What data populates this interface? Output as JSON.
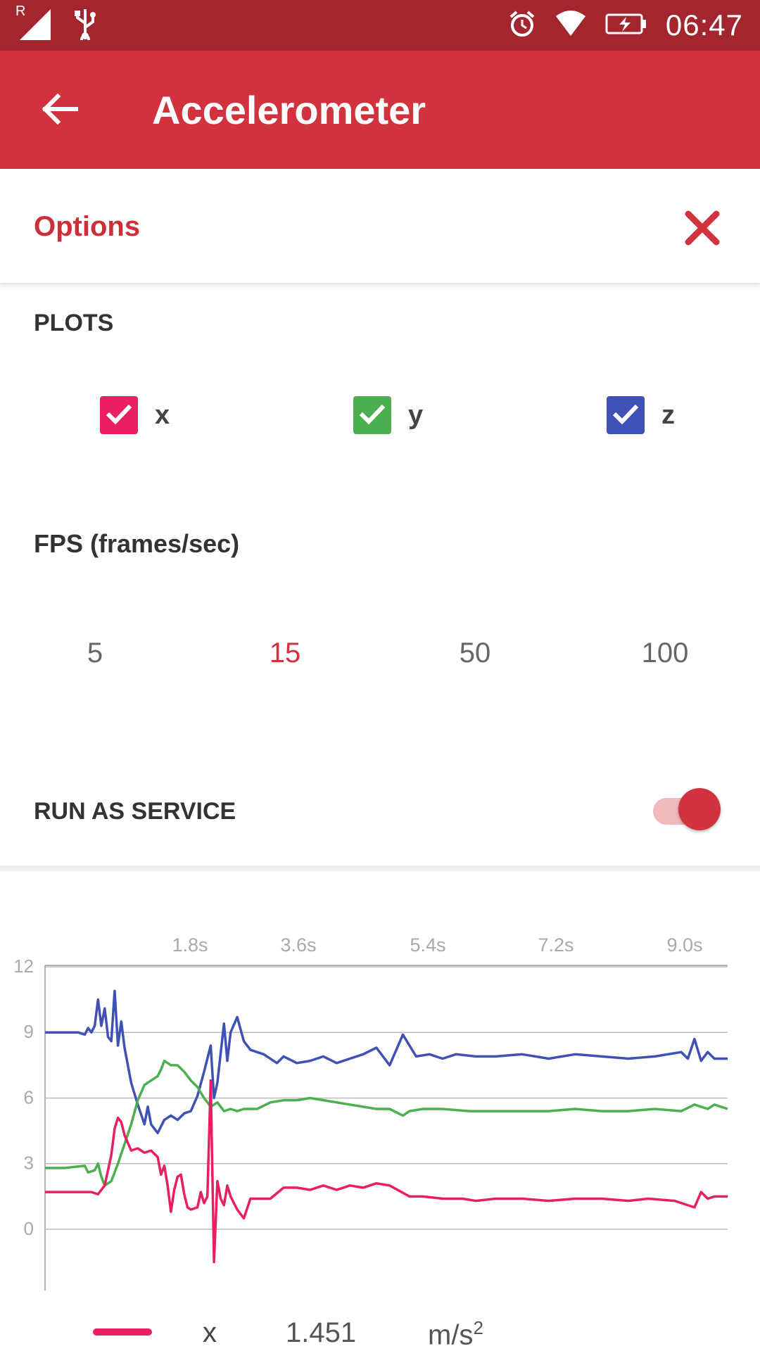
{
  "status_bar": {
    "time": "06:47",
    "signal_label": "R"
  },
  "app_bar": {
    "title": "Accelerometer"
  },
  "options": {
    "title": "Options",
    "plots_label": "PLOTS",
    "plots": [
      {
        "label": "x",
        "checked": true,
        "color": "#e91e63"
      },
      {
        "label": "y",
        "checked": true,
        "color": "#4caf50"
      },
      {
        "label": "z",
        "checked": true,
        "color": "#3f51b5"
      }
    ],
    "fps_label": "FPS (frames/sec)",
    "fps_options": [
      "5",
      "15",
      "50",
      "100"
    ],
    "fps_selected": "15",
    "run_as_service_label": "RUN AS SERVICE",
    "run_as_service": true
  },
  "chart_data": {
    "type": "line",
    "x_tick_labels": [
      "1.8s",
      "3.6s",
      "5.4s",
      "7.2s",
      "9.0s"
    ],
    "y_ticks": [
      12,
      9,
      6,
      3,
      0
    ],
    "ylim": [
      -2.8,
      12
    ],
    "x_range_s": [
      0,
      10.3
    ],
    "grid": true,
    "series": [
      {
        "name": "x",
        "color": "#e91e63",
        "points": [
          [
            0,
            1.7
          ],
          [
            0.5,
            1.7
          ],
          [
            0.7,
            1.7
          ],
          [
            0.8,
            1.6
          ],
          [
            0.9,
            2.0
          ],
          [
            1.0,
            3.4
          ],
          [
            1.05,
            4.6
          ],
          [
            1.1,
            5.1
          ],
          [
            1.15,
            4.9
          ],
          [
            1.2,
            4.3
          ],
          [
            1.3,
            3.6
          ],
          [
            1.4,
            3.7
          ],
          [
            1.5,
            3.5
          ],
          [
            1.6,
            3.6
          ],
          [
            1.7,
            3.3
          ],
          [
            1.75,
            2.5
          ],
          [
            1.8,
            2.9
          ],
          [
            1.85,
            2.0
          ],
          [
            1.9,
            0.8
          ],
          [
            1.95,
            1.8
          ],
          [
            2.0,
            2.4
          ],
          [
            2.05,
            2.5
          ],
          [
            2.1,
            1.6
          ],
          [
            2.15,
            1.0
          ],
          [
            2.2,
            0.9
          ],
          [
            2.3,
            1.0
          ],
          [
            2.35,
            1.7
          ],
          [
            2.4,
            1.2
          ],
          [
            2.45,
            1.5
          ],
          [
            2.5,
            6.8
          ],
          [
            2.55,
            -1.5
          ],
          [
            2.6,
            2.2
          ],
          [
            2.65,
            1.4
          ],
          [
            2.7,
            1.1
          ],
          [
            2.75,
            2.0
          ],
          [
            2.8,
            1.5
          ],
          [
            2.9,
            0.9
          ],
          [
            3.0,
            0.5
          ],
          [
            3.1,
            1.4
          ],
          [
            3.2,
            1.4
          ],
          [
            3.4,
            1.4
          ],
          [
            3.6,
            1.9
          ],
          [
            3.8,
            1.9
          ],
          [
            4.0,
            1.8
          ],
          [
            4.2,
            2.0
          ],
          [
            4.4,
            1.8
          ],
          [
            4.6,
            2.0
          ],
          [
            4.8,
            1.9
          ],
          [
            5.0,
            2.1
          ],
          [
            5.2,
            2.0
          ],
          [
            5.5,
            1.5
          ],
          [
            5.7,
            1.5
          ],
          [
            6.0,
            1.4
          ],
          [
            6.3,
            1.4
          ],
          [
            6.5,
            1.3
          ],
          [
            6.8,
            1.4
          ],
          [
            7.2,
            1.4
          ],
          [
            7.6,
            1.3
          ],
          [
            8.0,
            1.4
          ],
          [
            8.4,
            1.4
          ],
          [
            8.8,
            1.3
          ],
          [
            9.1,
            1.4
          ],
          [
            9.5,
            1.3
          ],
          [
            9.8,
            1.0
          ],
          [
            9.9,
            1.7
          ],
          [
            10.0,
            1.4
          ],
          [
            10.1,
            1.5
          ],
          [
            10.3,
            1.5
          ]
        ]
      },
      {
        "name": "y",
        "color": "#4caf50",
        "points": [
          [
            0,
            2.8
          ],
          [
            0.3,
            2.8
          ],
          [
            0.6,
            2.9
          ],
          [
            0.65,
            2.6
          ],
          [
            0.75,
            2.7
          ],
          [
            0.8,
            3.0
          ],
          [
            0.85,
            2.4
          ],
          [
            0.9,
            2.0
          ],
          [
            1.0,
            2.2
          ],
          [
            1.1,
            3.0
          ],
          [
            1.2,
            3.9
          ],
          [
            1.3,
            4.8
          ],
          [
            1.4,
            5.9
          ],
          [
            1.5,
            6.6
          ],
          [
            1.6,
            6.8
          ],
          [
            1.7,
            7.0
          ],
          [
            1.75,
            7.3
          ],
          [
            1.8,
            7.7
          ],
          [
            1.9,
            7.5
          ],
          [
            2.0,
            7.5
          ],
          [
            2.1,
            7.2
          ],
          [
            2.2,
            6.8
          ],
          [
            2.3,
            6.5
          ],
          [
            2.4,
            6.0
          ],
          [
            2.5,
            5.6
          ],
          [
            2.6,
            5.8
          ],
          [
            2.7,
            5.4
          ],
          [
            2.8,
            5.5
          ],
          [
            2.9,
            5.4
          ],
          [
            3.0,
            5.5
          ],
          [
            3.2,
            5.5
          ],
          [
            3.4,
            5.8
          ],
          [
            3.6,
            5.9
          ],
          [
            3.8,
            5.9
          ],
          [
            4.0,
            6.0
          ],
          [
            4.2,
            5.9
          ],
          [
            4.4,
            5.8
          ],
          [
            4.6,
            5.7
          ],
          [
            4.8,
            5.6
          ],
          [
            5.0,
            5.5
          ],
          [
            5.2,
            5.5
          ],
          [
            5.4,
            5.2
          ],
          [
            5.5,
            5.4
          ],
          [
            5.7,
            5.5
          ],
          [
            6.0,
            5.5
          ],
          [
            6.4,
            5.4
          ],
          [
            6.8,
            5.4
          ],
          [
            7.2,
            5.4
          ],
          [
            7.6,
            5.4
          ],
          [
            8.0,
            5.5
          ],
          [
            8.4,
            5.4
          ],
          [
            8.8,
            5.4
          ],
          [
            9.2,
            5.5
          ],
          [
            9.6,
            5.4
          ],
          [
            9.8,
            5.7
          ],
          [
            10.0,
            5.5
          ],
          [
            10.1,
            5.7
          ],
          [
            10.3,
            5.5
          ]
        ]
      },
      {
        "name": "z",
        "color": "#3f51b5",
        "points": [
          [
            0,
            9.0
          ],
          [
            0.3,
            9.0
          ],
          [
            0.5,
            9.0
          ],
          [
            0.6,
            8.9
          ],
          [
            0.65,
            9.2
          ],
          [
            0.7,
            9.0
          ],
          [
            0.75,
            9.3
          ],
          [
            0.8,
            10.5
          ],
          [
            0.85,
            9.3
          ],
          [
            0.9,
            10.1
          ],
          [
            0.95,
            8.8
          ],
          [
            1.0,
            8.6
          ],
          [
            1.05,
            10.9
          ],
          [
            1.1,
            8.4
          ],
          [
            1.15,
            9.5
          ],
          [
            1.2,
            8.3
          ],
          [
            1.3,
            6.7
          ],
          [
            1.4,
            5.7
          ],
          [
            1.5,
            4.8
          ],
          [
            1.55,
            5.6
          ],
          [
            1.6,
            4.8
          ],
          [
            1.7,
            4.4
          ],
          [
            1.8,
            5.0
          ],
          [
            1.9,
            5.2
          ],
          [
            2.0,
            5.0
          ],
          [
            2.1,
            5.3
          ],
          [
            2.2,
            5.4
          ],
          [
            2.3,
            6.1
          ],
          [
            2.4,
            7.2
          ],
          [
            2.5,
            8.4
          ],
          [
            2.55,
            6.0
          ],
          [
            2.6,
            6.7
          ],
          [
            2.7,
            9.4
          ],
          [
            2.75,
            7.7
          ],
          [
            2.8,
            9.0
          ],
          [
            2.9,
            9.7
          ],
          [
            3.0,
            8.6
          ],
          [
            3.1,
            8.2
          ],
          [
            3.3,
            8.0
          ],
          [
            3.5,
            7.6
          ],
          [
            3.6,
            7.9
          ],
          [
            3.8,
            7.6
          ],
          [
            4.0,
            7.7
          ],
          [
            4.2,
            7.9
          ],
          [
            4.4,
            7.6
          ],
          [
            4.6,
            7.8
          ],
          [
            4.8,
            8.0
          ],
          [
            5.0,
            8.3
          ],
          [
            5.2,
            7.5
          ],
          [
            5.4,
            8.9
          ],
          [
            5.6,
            7.9
          ],
          [
            5.8,
            8.0
          ],
          [
            6.0,
            7.8
          ],
          [
            6.2,
            8.0
          ],
          [
            6.5,
            7.9
          ],
          [
            6.8,
            7.9
          ],
          [
            7.2,
            8.0
          ],
          [
            7.6,
            7.8
          ],
          [
            8.0,
            8.0
          ],
          [
            8.4,
            7.9
          ],
          [
            8.8,
            7.8
          ],
          [
            9.2,
            7.9
          ],
          [
            9.6,
            8.1
          ],
          [
            9.7,
            7.8
          ],
          [
            9.8,
            8.7
          ],
          [
            9.9,
            7.7
          ],
          [
            10.0,
            8.1
          ],
          [
            10.1,
            7.8
          ],
          [
            10.3,
            7.8
          ]
        ]
      }
    ]
  },
  "legend": {
    "label": "x",
    "value": "1.451",
    "unit": "m/s",
    "unit_exponent": "2",
    "color": "#e91e63"
  }
}
